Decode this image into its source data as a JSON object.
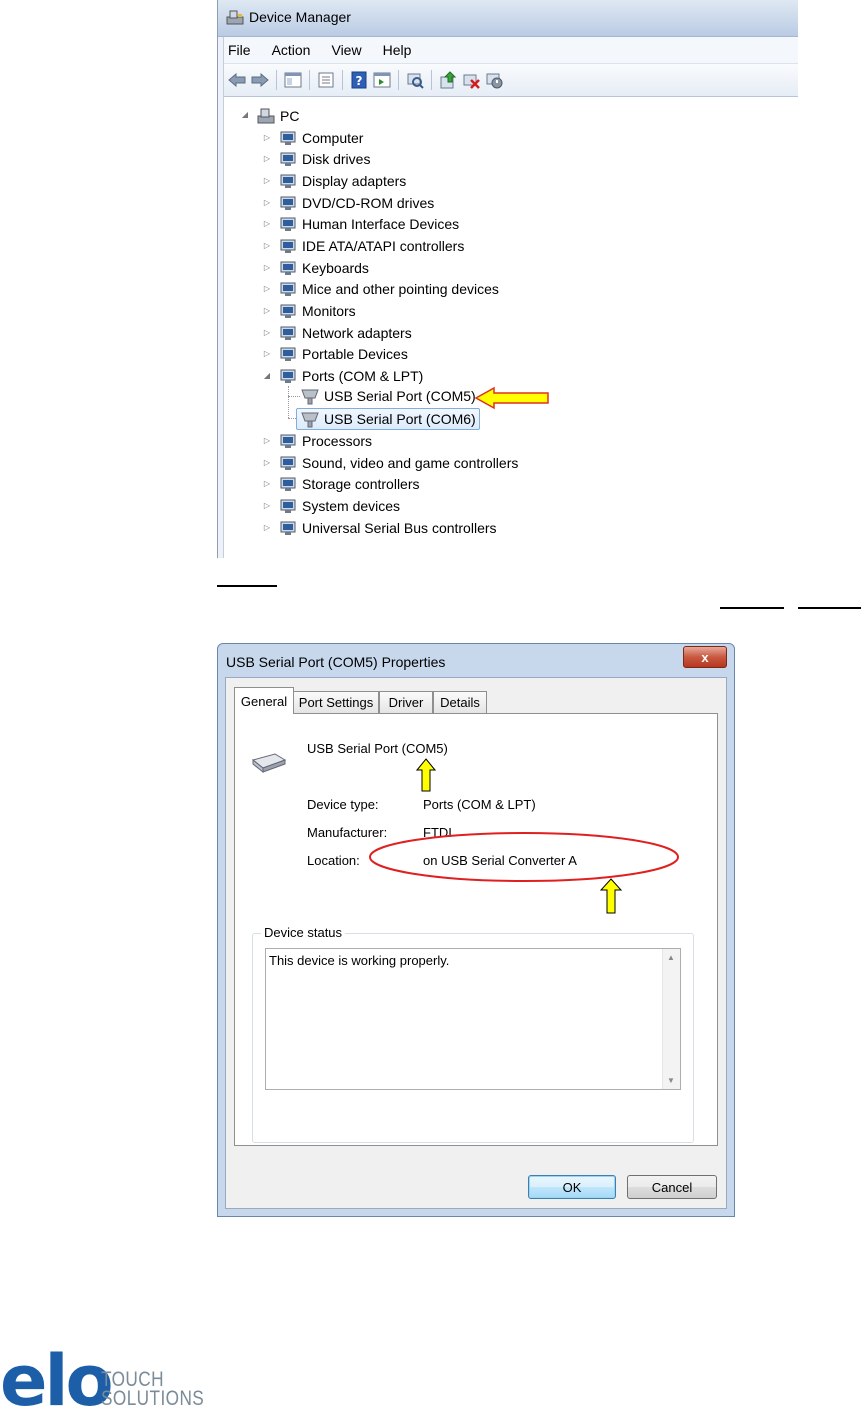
{
  "device_manager": {
    "title": "Device Manager",
    "menu": [
      "File",
      "Action",
      "View",
      "Help"
    ],
    "toolbar_icons": [
      "back-icon",
      "forward-icon",
      "show-hide-console-tree-icon",
      "properties-icon",
      "help-icon",
      "action-pane-icon",
      "scan-hardware-icon",
      "update-driver-icon",
      "uninstall-icon",
      "disable-icon"
    ],
    "tree": {
      "root": "PC",
      "categories": [
        {
          "label": "Computer",
          "icon": "computer-icon"
        },
        {
          "label": "Disk drives",
          "icon": "disk-drive-icon"
        },
        {
          "label": "Display adapters",
          "icon": "display-adapter-icon"
        },
        {
          "label": "DVD/CD-ROM drives",
          "icon": "dvd-drive-icon"
        },
        {
          "label": "Human Interface Devices",
          "icon": "hid-icon"
        },
        {
          "label": "IDE ATA/ATAPI controllers",
          "icon": "ide-controller-icon"
        },
        {
          "label": "Keyboards",
          "icon": "keyboard-icon"
        },
        {
          "label": "Mice and other pointing devices",
          "icon": "mouse-icon"
        },
        {
          "label": "Monitors",
          "icon": "monitor-icon"
        },
        {
          "label": "Network adapters",
          "icon": "network-adapter-icon"
        },
        {
          "label": "Portable Devices",
          "icon": "portable-device-icon"
        },
        {
          "label": "Ports (COM & LPT)",
          "icon": "port-icon"
        },
        {
          "label": "Processors",
          "icon": "processor-icon"
        },
        {
          "label": "Sound, video and game controllers",
          "icon": "speaker-icon"
        },
        {
          "label": "Storage controllers",
          "icon": "storage-controller-icon"
        },
        {
          "label": "System devices",
          "icon": "system-device-icon"
        },
        {
          "label": "Universal Serial Bus controllers",
          "icon": "usb-icon"
        }
      ],
      "ports_children": [
        "USB Serial Port (COM5)",
        "USB Serial Port (COM6)"
      ]
    }
  },
  "properties_dialog": {
    "title": "USB Serial Port (COM5) Properties",
    "close_label": "x",
    "tabs": [
      "General",
      "Port Settings",
      "Driver",
      "Details"
    ],
    "active_tab": "General",
    "device_name": "USB Serial Port (COM5)",
    "fields": {
      "device_type_label": "Device type:",
      "device_type_value": "Ports (COM & LPT)",
      "manufacturer_label": "Manufacturer:",
      "manufacturer_value": "FTDI",
      "location_label": "Location:",
      "location_value": "on USB Serial Converter A"
    },
    "status_group_label": "Device status",
    "status_text": "This device is working properly.",
    "ok_label": "OK",
    "cancel_label": "Cancel"
  },
  "logo": {
    "mark": "elo",
    "line1": "TOUCH",
    "line2": "SOLUTIONS"
  },
  "colors": {
    "arrow_fill": "#ffff00",
    "arrow_red_outline": "#e03020",
    "highlight_ellipse": "#e02020",
    "logo_blue": "#1c5fa8",
    "logo_gray": "#7b8b98"
  }
}
